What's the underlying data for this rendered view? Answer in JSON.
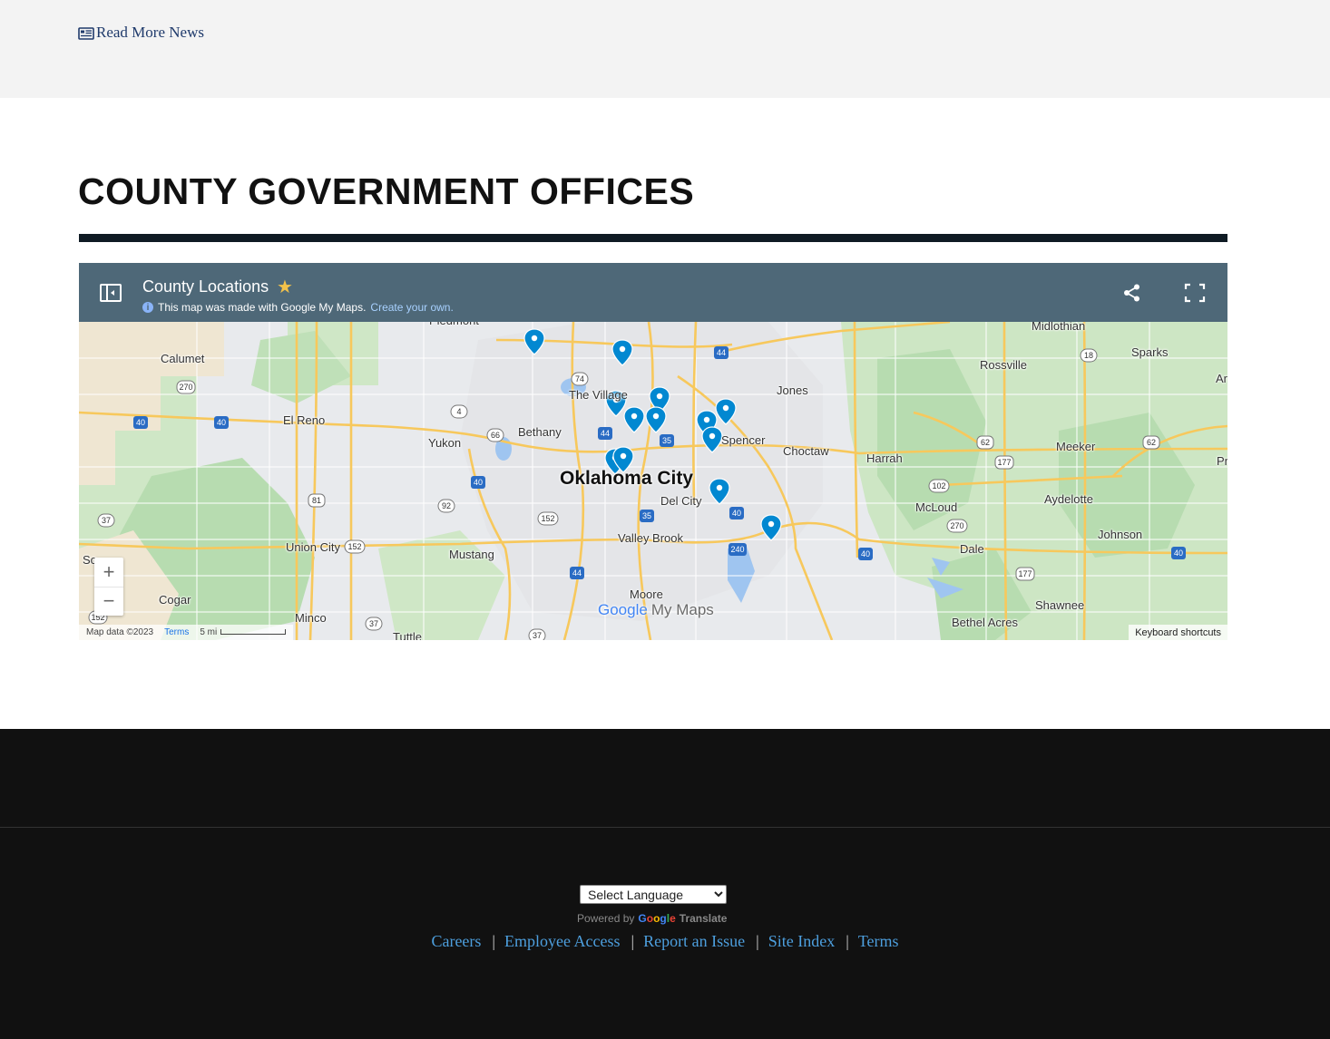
{
  "news": {
    "read_more": "Read More News"
  },
  "section": {
    "title": "COUNTY GOVERNMENT OFFICES"
  },
  "map": {
    "title": "County Locations",
    "subtitle": "This map was made with Google My Maps.",
    "create_link": "Create your own.",
    "logo_google": "Google",
    "logo_mymaps": "My Maps",
    "attribution": "Map data ©2023",
    "terms": "Terms",
    "scale": "5 mi",
    "keyboard_shortcuts": "Keyboard shortcuts",
    "zoom_in": "+",
    "zoom_out": "−",
    "colors": {
      "header": "#4e6878",
      "marker": "#0288d1",
      "star": "#f3c24a"
    },
    "places": {
      "piedmont": "Piedmont",
      "calumet": "Calumet",
      "midlothian": "Midlothian",
      "sparks": "Sparks",
      "rossville": "Rossville",
      "jones": "Jones",
      "the_village": "The Village",
      "el_reno": "El Reno",
      "bethany": "Bethany",
      "yukon": "Yukon",
      "spencer": "Spencer",
      "choctaw": "Choctaw",
      "harrah": "Harrah",
      "meeker": "Meeker",
      "oklahoma_city": "Oklahoma City",
      "del_city": "Del City",
      "mcloud": "McLoud",
      "aydelotte": "Aydelotte",
      "valley_brook": "Valley Brook",
      "union_city": "Union City",
      "mustang": "Mustang",
      "johnson": "Johnson",
      "dale": "Dale",
      "cogar": "Cogar",
      "moore": "Moore",
      "minco": "Minco",
      "tuttle": "Tuttle",
      "shawnee": "Shawnee",
      "bethel_acres": "Bethel Acres",
      "prague": "Pr",
      "arcadia": "Ar",
      "south": "So"
    },
    "shields": [
      "270",
      "40",
      "40",
      "4",
      "74",
      "44",
      "66",
      "44",
      "35",
      "62",
      "177",
      "62",
      "40",
      "92",
      "81",
      "152",
      "37",
      "35",
      "40",
      "102",
      "270",
      "152",
      "240",
      "40",
      "40",
      "44",
      "37",
      "152",
      "177",
      "37",
      "18"
    ]
  },
  "footer": {
    "language_select": "Select Language",
    "powered_by": "Powered by",
    "translate": "Translate",
    "links": {
      "careers": "Careers",
      "employee_access": "Employee Access",
      "report_issue": "Report an Issue",
      "site_index": "Site Index",
      "terms": "Terms"
    },
    "separator": "|"
  }
}
